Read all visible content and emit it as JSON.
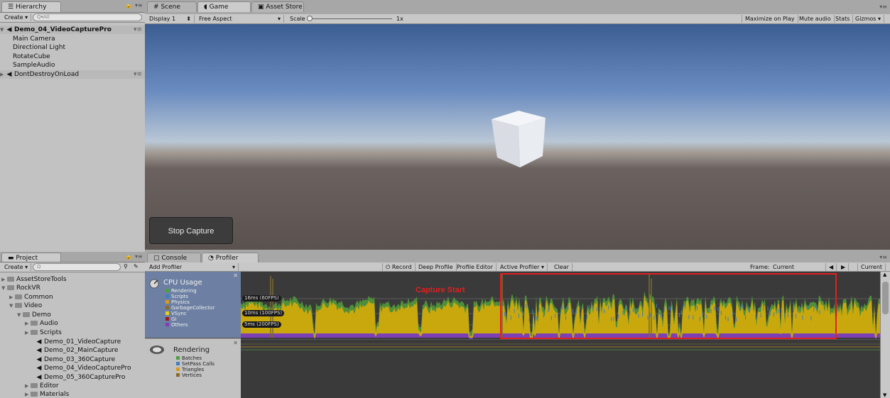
{
  "hierarchy": {
    "tab_label": "Hierarchy",
    "create_label": "Create ▾",
    "search_placeholder": "Q▾All",
    "items": [
      {
        "label": "Demo_04_VideoCapturePro"
      },
      {
        "label": "Main Camera"
      },
      {
        "label": "Directional Light"
      },
      {
        "label": "RotateCube"
      },
      {
        "label": "SampleAudio"
      },
      {
        "label": "DontDestroyOnLoad"
      }
    ]
  },
  "scene_tabs": [
    {
      "label": "Scene",
      "icon": "grid-icon"
    },
    {
      "label": "Game",
      "icon": "game-icon"
    },
    {
      "label": "Asset Store",
      "icon": "store-icon"
    }
  ],
  "game_toolbar": {
    "display": "Display 1",
    "aspect": "Free Aspect",
    "scale_label": "Scale",
    "scale_value": "1x",
    "maximize": "Maximize on Play",
    "mute": "Mute audio",
    "stats": "Stats",
    "gizmos": "Gizmos"
  },
  "game_view": {
    "stop_capture_label": "Stop Capture"
  },
  "project": {
    "tab_label": "Project",
    "create_label": "Create ▾",
    "search_placeholder": "Q",
    "items": [
      {
        "label": "AssetStoreTools"
      },
      {
        "label": "RockVR"
      },
      {
        "label": "Common"
      },
      {
        "label": "Video"
      },
      {
        "label": "Demo"
      },
      {
        "label": "Audio"
      },
      {
        "label": "Scripts"
      },
      {
        "label": "Demo_01_VideoCapture"
      },
      {
        "label": "Demo_02_MainCapture"
      },
      {
        "label": "Demo_03_360Capture"
      },
      {
        "label": "Demo_04_VideoCapturePro"
      },
      {
        "label": "Demo_05_360CapturePro"
      },
      {
        "label": "Editor"
      },
      {
        "label": "Materials"
      }
    ]
  },
  "bottom_tabs": [
    {
      "label": "Console"
    },
    {
      "label": "Profiler"
    }
  ],
  "profiler_toolbar": {
    "add_profiler": "Add Profiler",
    "record": "Record",
    "deep_profile": "Deep Profile",
    "profile_editor": "Profile Editor",
    "active_profiler": "Active Profiler",
    "clear": "Clear",
    "frame_label": "Frame:",
    "frame_value": "Current",
    "current_button": "Current"
  },
  "cpu_module": {
    "title": "CPU Usage",
    "legend": [
      {
        "label": "Rendering",
        "color": "#4f9e44"
      },
      {
        "label": "Scripts",
        "color": "#3f7ec0"
      },
      {
        "label": "Physics",
        "color": "#d99a1c"
      },
      {
        "label": "GarbageCollector",
        "color": "#8b6a2c"
      },
      {
        "label": "VSync",
        "color": "#e6d21a"
      },
      {
        "label": "Gi",
        "color": "#9b1c1c"
      },
      {
        "label": "Others",
        "color": "#7d3fb5"
      }
    ],
    "markers": [
      {
        "label": "16ms (60FPS)"
      },
      {
        "label": "10ms (100FPS)"
      },
      {
        "label": "5ms (200FPS)"
      }
    ],
    "annotation": "Capture Start",
    "annotation_color": "#e02020"
  },
  "rendering_module": {
    "title": "Rendering",
    "legend": [
      {
        "label": "Batches",
        "color": "#4f9e44"
      },
      {
        "label": "SetPass Calls",
        "color": "#3f7ec0"
      },
      {
        "label": "Triangles",
        "color": "#d99a1c"
      },
      {
        "label": "Vertices",
        "color": "#8b6a2c"
      }
    ]
  }
}
